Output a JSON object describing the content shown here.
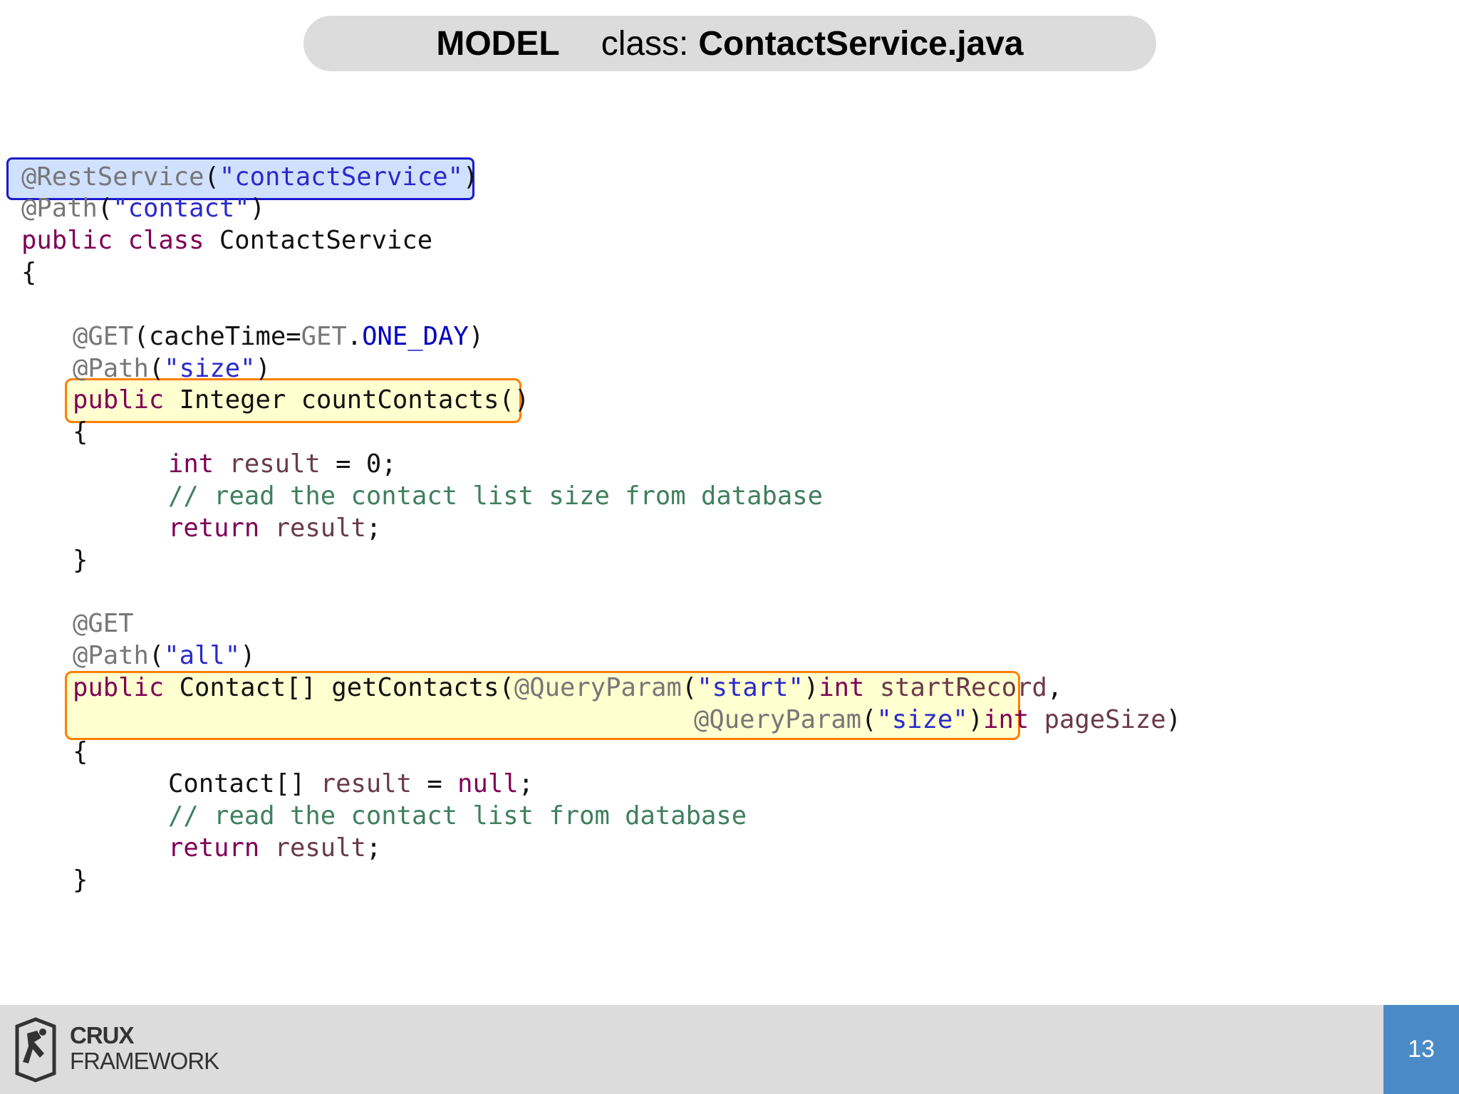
{
  "header": {
    "model_label": "MODEL",
    "class_label": "class:",
    "class_name": "ContactService.java"
  },
  "code": {
    "l1_ann": "@RestService",
    "l1_open": "(",
    "l1_str": "\"contactService\"",
    "l1_close": ")",
    "l2_ann": "@Path",
    "l2_open": "(",
    "l2_str": "\"contact\"",
    "l2_close": ")",
    "l3_kw1": "public",
    "l3_kw2": "class",
    "l3_name": "ContactService",
    "l4": "{",
    "l5_ann": "@GET",
    "l5_mid": "(cacheTime=",
    "l5_ann2": "GET",
    "l5_dot": ".",
    "l5_const": "ONE_DAY",
    "l5_close": ")",
    "l6_ann": "@Path",
    "l6_open": "(",
    "l6_str": "\"size\"",
    "l6_close": ")",
    "l7_kw": "public",
    "l7_rest": "Integer countContacts()",
    "l8": "{",
    "l9_kw": "int",
    "l9_var": "result",
    "l9_rest": "= 0;",
    "l10_cm": "// read the contact list size from database",
    "l11_kw": "return",
    "l11_var": "result",
    "l11_semi": ";",
    "l12": "}",
    "l13_ann": "@GET",
    "l14_ann": "@Path",
    "l14_open": "(",
    "l14_str": "\"all\"",
    "l14_close": ")",
    "l15_kw": "public",
    "l15_mid": "Contact[] getContacts(",
    "l15_ann": "@QueryParam",
    "l15_open": "(",
    "l15_str": "\"start\"",
    "l15_close": ")",
    "l15_kw2": "int",
    "l15_var": "startRecord",
    "l15_comma": ",",
    "l16_ann": "@QueryParam",
    "l16_open": "(",
    "l16_str": "\"size\"",
    "l16_close": ")",
    "l16_kw": "int",
    "l16_var": "pageSize",
    "l16_end": ")",
    "l17": "{",
    "l18_type": "Contact[]",
    "l18_var": "result",
    "l18_eq": "=",
    "l18_kw": "null",
    "l18_semi": ";",
    "l19_cm": "// read the contact list from database",
    "l20_kw": "return",
    "l20_var": "result",
    "l20_semi": ";",
    "l21": "}"
  },
  "footer": {
    "brand_line1": "CRUX",
    "brand_line2": "FRAMEWORK",
    "page_number": "13"
  },
  "colors": {
    "annotation": "#777777",
    "string": "#2a2acc",
    "keyword": "#7f0055",
    "comment": "#3f7f5f",
    "highlight_blue_border": "#1a1acc",
    "highlight_orange_border": "#ff7f00",
    "page_box": "#4a8bc7"
  },
  "icons": {
    "logo": "crux-climber-logo"
  }
}
